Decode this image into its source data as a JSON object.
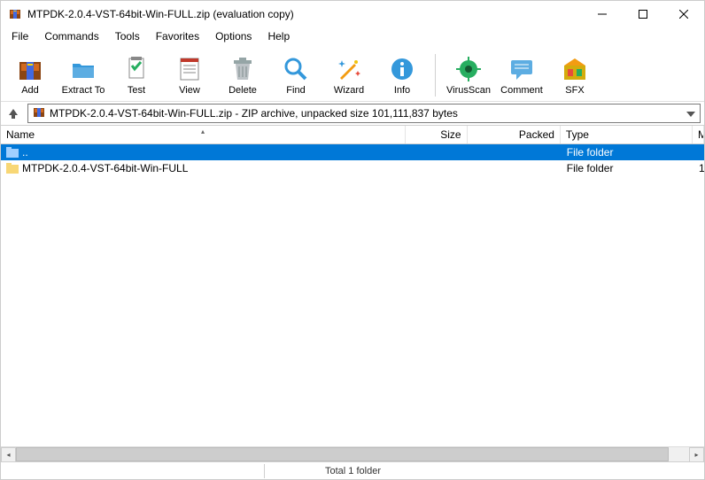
{
  "title": "MTPDK-2.0.4-VST-64bit-Win-FULL.zip (evaluation copy)",
  "menu": [
    "File",
    "Commands",
    "Tools",
    "Favorites",
    "Options",
    "Help"
  ],
  "toolbar": [
    {
      "label": "Add",
      "icon": "add"
    },
    {
      "label": "Extract To",
      "icon": "extract"
    },
    {
      "label": "Test",
      "icon": "test"
    },
    {
      "label": "View",
      "icon": "view"
    },
    {
      "label": "Delete",
      "icon": "delete"
    },
    {
      "label": "Find",
      "icon": "find"
    },
    {
      "label": "Wizard",
      "icon": "wizard"
    },
    {
      "label": "Info",
      "icon": "info"
    }
  ],
  "toolbar2": [
    {
      "label": "VirusScan",
      "icon": "virus"
    },
    {
      "label": "Comment",
      "icon": "comment"
    },
    {
      "label": "SFX",
      "icon": "sfx"
    }
  ],
  "path": "MTPDK-2.0.4-VST-64bit-Win-FULL.zip - ZIP archive, unpacked size 101,111,837 bytes",
  "columns": {
    "name": "Name",
    "size": "Size",
    "packed": "Packed",
    "type": "Type",
    "extra": "M"
  },
  "rows": [
    {
      "name": "..",
      "size": "",
      "packed": "",
      "type": "File folder",
      "extra": "",
      "icon": "up",
      "selected": true
    },
    {
      "name": "MTPDK-2.0.4-VST-64bit-Win-FULL",
      "size": "",
      "packed": "",
      "type": "File folder",
      "extra": "1",
      "icon": "folder",
      "selected": false
    }
  ],
  "status": "Total 1 folder"
}
